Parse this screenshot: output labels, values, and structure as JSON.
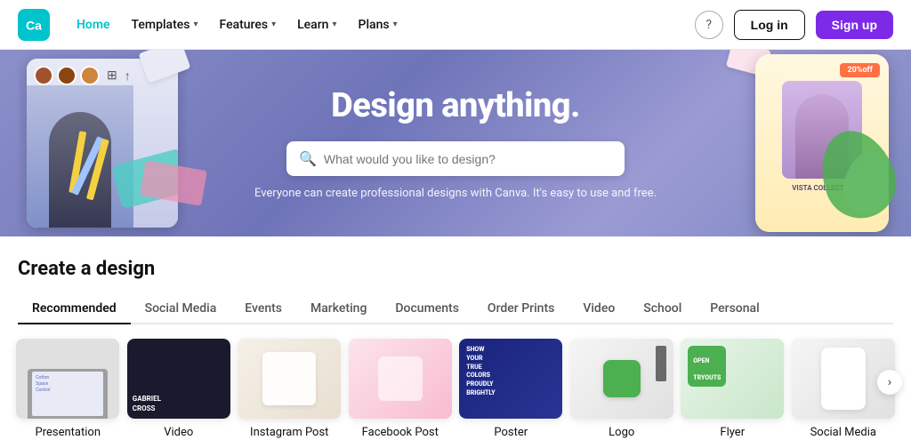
{
  "brand": {
    "name": "Canva",
    "logo_color": "#00c4cc"
  },
  "navbar": {
    "home_label": "Home",
    "templates_label": "Templates",
    "features_label": "Features",
    "learn_label": "Learn",
    "plans_label": "Plans",
    "help_icon": "?",
    "login_label": "Log in",
    "signup_label": "Sign up"
  },
  "hero": {
    "title": "Design anything.",
    "search_placeholder": "What would you like to design?",
    "subtitle": "Everyone can create professional designs with Canva. It's easy to use and free.",
    "badge_text": "20%off",
    "vista_text": "VISTA\nCOLLECTI...",
    "open_tryouts": "OPEN\nTRYOUTS"
  },
  "create_section": {
    "title": "Create a design",
    "tabs": [
      {
        "id": "recommended",
        "label": "Recommended",
        "active": true
      },
      {
        "id": "social-media",
        "label": "Social Media",
        "active": false
      },
      {
        "id": "events",
        "label": "Events",
        "active": false
      },
      {
        "id": "marketing",
        "label": "Marketing",
        "active": false
      },
      {
        "id": "documents",
        "label": "Documents",
        "active": false
      },
      {
        "id": "order-prints",
        "label": "Order Prints",
        "active": false
      },
      {
        "id": "video",
        "label": "Video",
        "active": false
      },
      {
        "id": "school",
        "label": "School",
        "active": false
      },
      {
        "id": "personal",
        "label": "Personal",
        "active": false
      }
    ],
    "cards": [
      {
        "id": "presentation",
        "label": "Presentation",
        "bg": "presentation"
      },
      {
        "id": "video",
        "label": "Video",
        "bg": "video",
        "overlay_text": "GABRIEL CROSS"
      },
      {
        "id": "instagram-post",
        "label": "Instagram Post",
        "bg": "instagram"
      },
      {
        "id": "facebook-post",
        "label": "Facebook Post",
        "bg": "facebook"
      },
      {
        "id": "poster",
        "label": "Poster",
        "bg": "poster",
        "overlay_text": "SHOW YOUR TRUE COLORS PROUDLY BRIGHTLY"
      },
      {
        "id": "logo",
        "label": "Logo",
        "bg": "logo"
      },
      {
        "id": "flyer",
        "label": "Flyer",
        "bg": "flyer",
        "overlay_text": "OPEN TRYOUTS"
      },
      {
        "id": "social-media",
        "label": "Social Media",
        "bg": "social"
      }
    ],
    "next_button": "›"
  }
}
